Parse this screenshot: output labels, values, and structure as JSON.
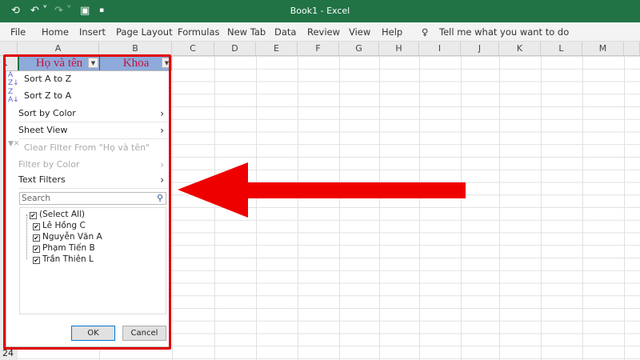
{
  "titlebar": {
    "title": "Book1  -  Excel",
    "icons": [
      "autosave-icon",
      "undo-icon",
      "redo-icon",
      "form-icon",
      "customize-icon"
    ]
  },
  "menu": [
    "File",
    "Home",
    "Insert",
    "Page Layout",
    "Formulas",
    "New Tab",
    "Data",
    "Review",
    "View",
    "Help"
  ],
  "tell_me": "Tell me what you want to do",
  "columns": [
    "A",
    "B",
    "C",
    "D",
    "E",
    "F",
    "G",
    "H",
    "I",
    "J",
    "K",
    "L",
    "M"
  ],
  "rows": {
    "first": "1",
    "last": "24"
  },
  "headers": {
    "a": "Họ và tên",
    "b": "Khoa"
  },
  "filter_menu": {
    "sort_az": "Sort A to Z",
    "sort_za": "Sort Z to A",
    "sort_color": "Sort by Color",
    "sheet_view": "Sheet View",
    "clear_filter": "Clear Filter From \"Họ và tên\"",
    "filter_color": "Filter by Color",
    "text_filters": "Text Filters",
    "search_placeholder": "Search",
    "items": [
      "(Select All)",
      "Lê Hồng C",
      "Nguyễn Văn A",
      "Phạm Tiến B",
      "Trần Thiên L"
    ],
    "ok": "OK",
    "cancel": "Cancel"
  },
  "colors": {
    "accent": "#217346",
    "highlight": "#e00000",
    "header_fill": "#8eaadb"
  }
}
